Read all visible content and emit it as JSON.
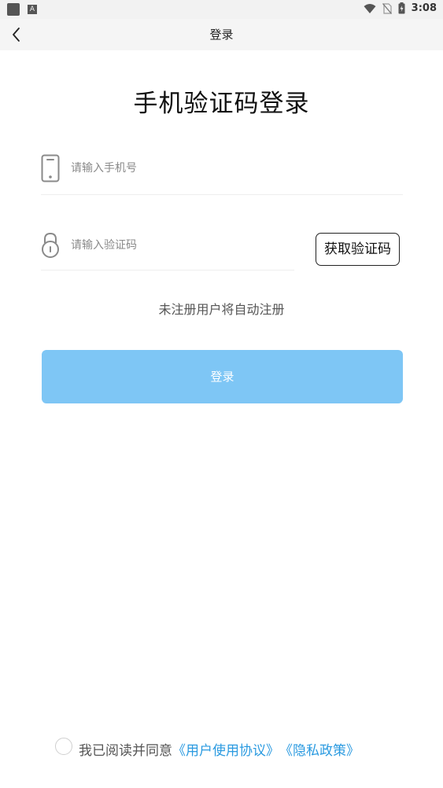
{
  "status_bar": {
    "time": "3:08",
    "left_icons": [
      "sd-card-icon",
      "app-a-icon"
    ],
    "right_icons": [
      "wifi-icon",
      "no-sim-icon",
      "battery-icon"
    ],
    "a_glyph": "A"
  },
  "nav": {
    "title": "登录",
    "back_icon": "chevron-left-icon"
  },
  "page_title": "手机验证码登录",
  "phone_field": {
    "placeholder": "请输入手机号",
    "value": "",
    "icon": "phone-icon"
  },
  "code_field": {
    "placeholder": "请输入验证码",
    "value": "",
    "icon": "lock-icon"
  },
  "get_code_label": "获取验证码",
  "hint": "未注册用户将自动注册",
  "login_label": "登录",
  "agreement": {
    "prefix": "我已阅读并同意",
    "user_agreement": "《用户使用协议》",
    "privacy_policy": "《隐私政策》",
    "checked": false
  },
  "colors": {
    "accent": "#7ec6f5",
    "link": "#2a9ae0"
  }
}
